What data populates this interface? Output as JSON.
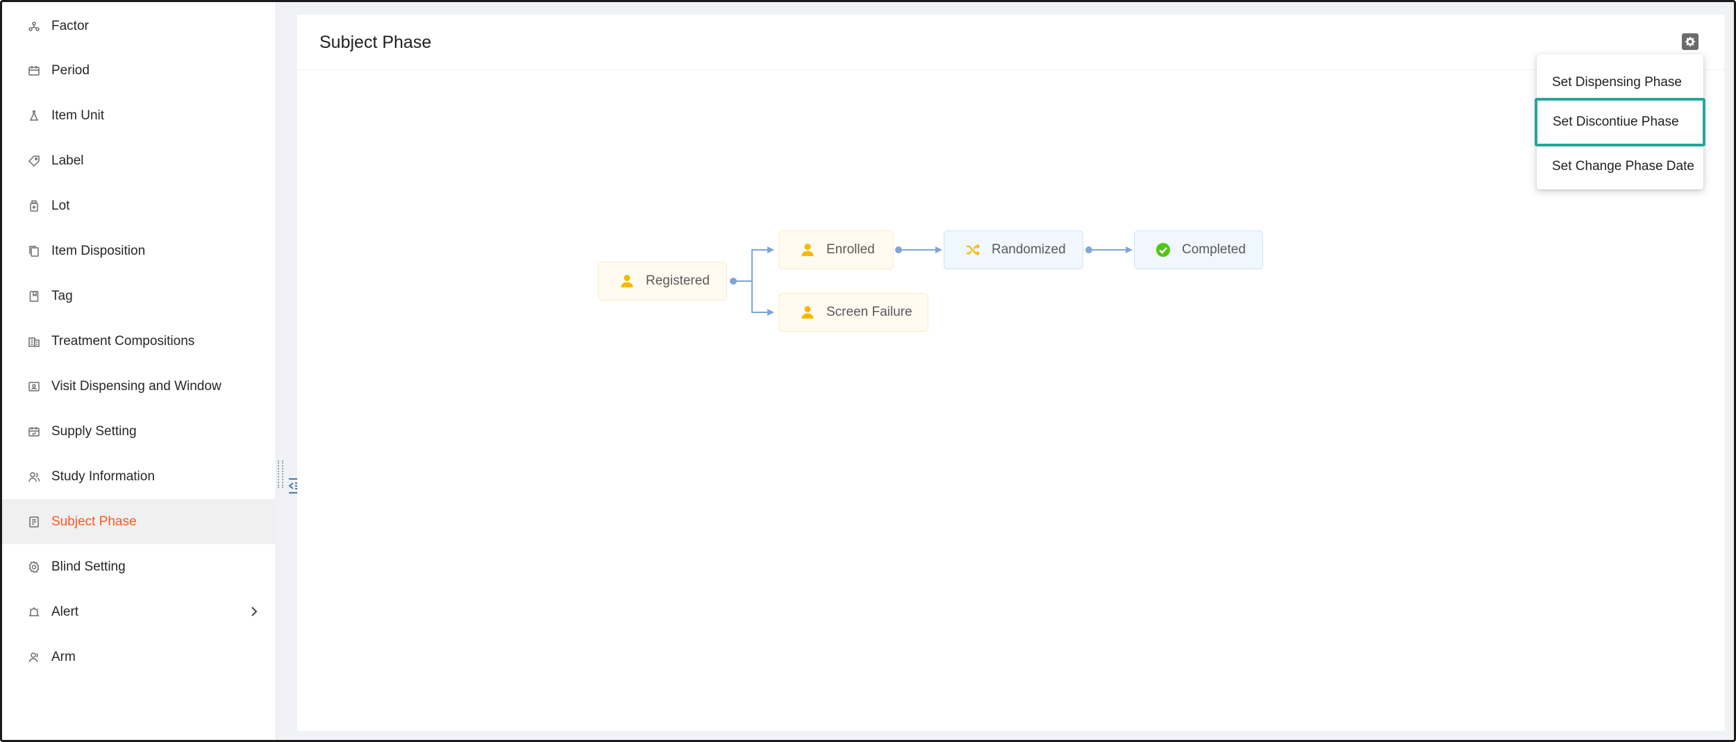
{
  "sidebar": {
    "items": [
      {
        "label": "Factor",
        "icon": "factor-icon"
      },
      {
        "label": "Period",
        "icon": "calendar-icon"
      },
      {
        "label": "Item Unit",
        "icon": "flask-icon"
      },
      {
        "label": "Label",
        "icon": "tag-icon"
      },
      {
        "label": "Lot",
        "icon": "bottle-icon"
      },
      {
        "label": "Item Disposition",
        "icon": "document-copy-icon"
      },
      {
        "label": "Tag",
        "icon": "bookmark-icon"
      },
      {
        "label": "Treatment Compositions",
        "icon": "building-icon"
      },
      {
        "label": "Visit Dispensing and Window",
        "icon": "id-card-icon"
      },
      {
        "label": "Supply Setting",
        "icon": "calendar-check-icon"
      },
      {
        "label": "Study Information",
        "icon": "user-group-icon"
      },
      {
        "label": "Subject Phase",
        "icon": "list-doc-icon",
        "active": true
      },
      {
        "label": "Blind Setting",
        "icon": "settings-icon"
      },
      {
        "label": "Alert",
        "icon": "alarm-icon",
        "has_children": true
      },
      {
        "label": "Arm",
        "icon": "user-icon"
      }
    ],
    "active_color": "#ff5722"
  },
  "main": {
    "title": "Subject Phase"
  },
  "settings_menu": {
    "items": [
      {
        "label": "Set Dispensing Phase"
      },
      {
        "label": "Set Discontiue Phase",
        "selected": true
      },
      {
        "label": "Set Change Phase Date"
      }
    ],
    "highlight_color": "#26a69a"
  },
  "flow": {
    "nodes": [
      {
        "id": "registered",
        "label": "Registered",
        "icon": "person-icon",
        "color": "yellow"
      },
      {
        "id": "enrolled",
        "label": "Enrolled",
        "icon": "person-icon",
        "color": "yellow"
      },
      {
        "id": "screen_failure",
        "label": "Screen Failure",
        "icon": "person-icon",
        "color": "yellow"
      },
      {
        "id": "randomized",
        "label": "Randomized",
        "icon": "shuffle-icon",
        "color": "blue"
      },
      {
        "id": "completed",
        "label": "Completed",
        "icon": "check-circle-icon",
        "color": "blue"
      }
    ],
    "edges": [
      [
        "registered",
        "enrolled"
      ],
      [
        "registered",
        "screen_failure"
      ],
      [
        "enrolled",
        "randomized"
      ],
      [
        "randomized",
        "completed"
      ]
    ],
    "icon_yellow": "#f5b800",
    "icon_green": "#52c41a",
    "edge_color": "#7ea6d6"
  }
}
